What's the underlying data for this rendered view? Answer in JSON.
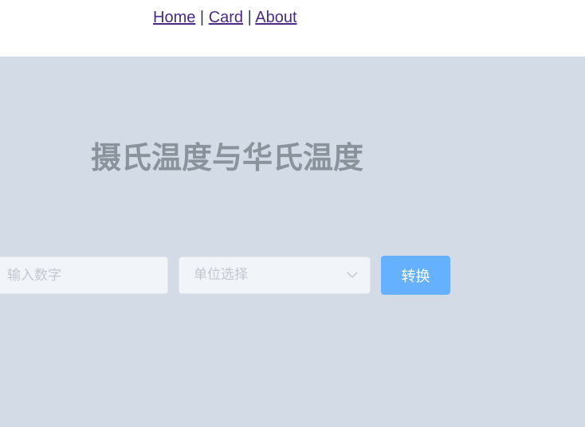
{
  "nav": {
    "home": "Home",
    "card": "Card",
    "about": "About",
    "separator": "|"
  },
  "main": {
    "title": "摄氏温度与华氏温度",
    "number_input": {
      "placeholder": "输入数字",
      "value": ""
    },
    "unit_select": {
      "placeholder": "单位选择",
      "selected": ""
    },
    "convert_label": "转换"
  },
  "colors": {
    "panel_bg": "#d3dbe6",
    "link": "#4b2a87",
    "title": "#8a929c",
    "primary_button": "#66b1ff"
  }
}
